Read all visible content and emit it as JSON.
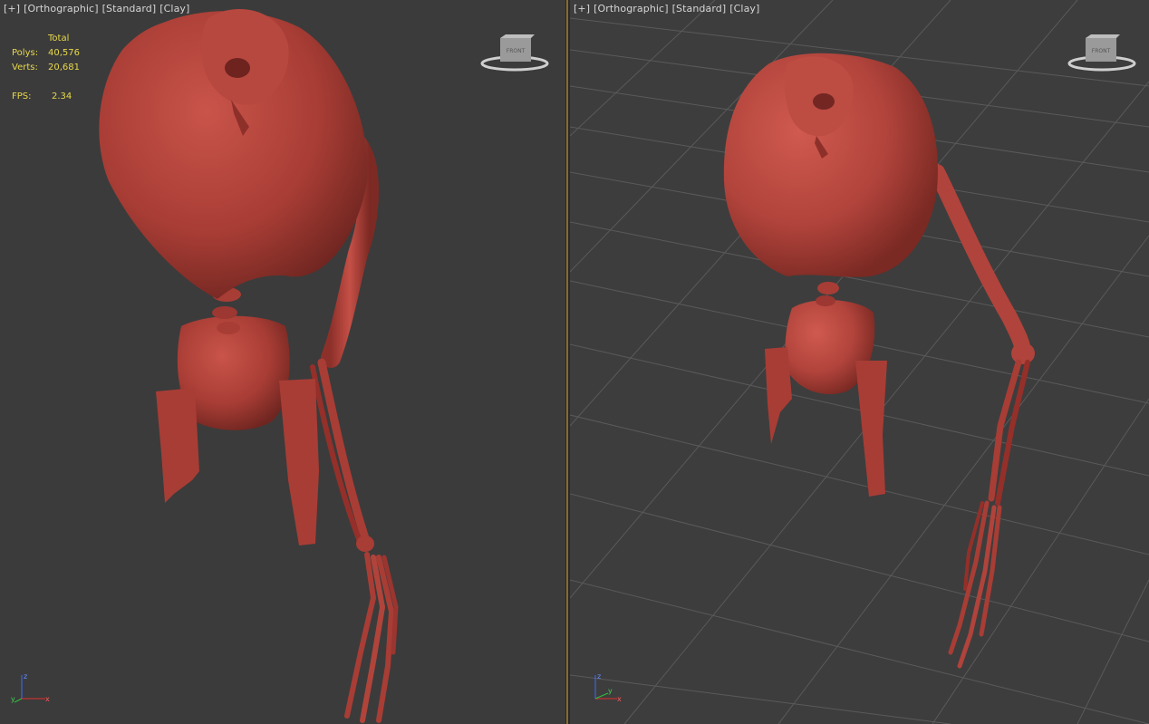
{
  "viewports": {
    "left": {
      "label": {
        "plus": "[+]",
        "view": "[Orthographic]",
        "shading": "[Standard]",
        "style": "[Clay]"
      },
      "viewcube_face": "FRONT",
      "stats": {
        "header": "Total",
        "polys_label": "Polys:",
        "polys_value": "40,576",
        "verts_label": "Verts:",
        "verts_value": "20,681",
        "fps_label": "FPS:",
        "fps_value": "2.34"
      },
      "axis": {
        "z": "z",
        "x": "x",
        "y": "y"
      }
    },
    "right": {
      "label": {
        "plus": "[+]",
        "view": "[Orthographic]",
        "shading": "[Standard]",
        "style": "[Clay]"
      },
      "viewcube_face": "FRONT",
      "axis": {
        "z": "z",
        "x": "x",
        "y": "y"
      }
    }
  },
  "colors": {
    "viewport_bg": "#3b3b3b",
    "active_border": "#8a6a2c",
    "clay": "#b8453c",
    "stats_text": "#e8d84a"
  }
}
